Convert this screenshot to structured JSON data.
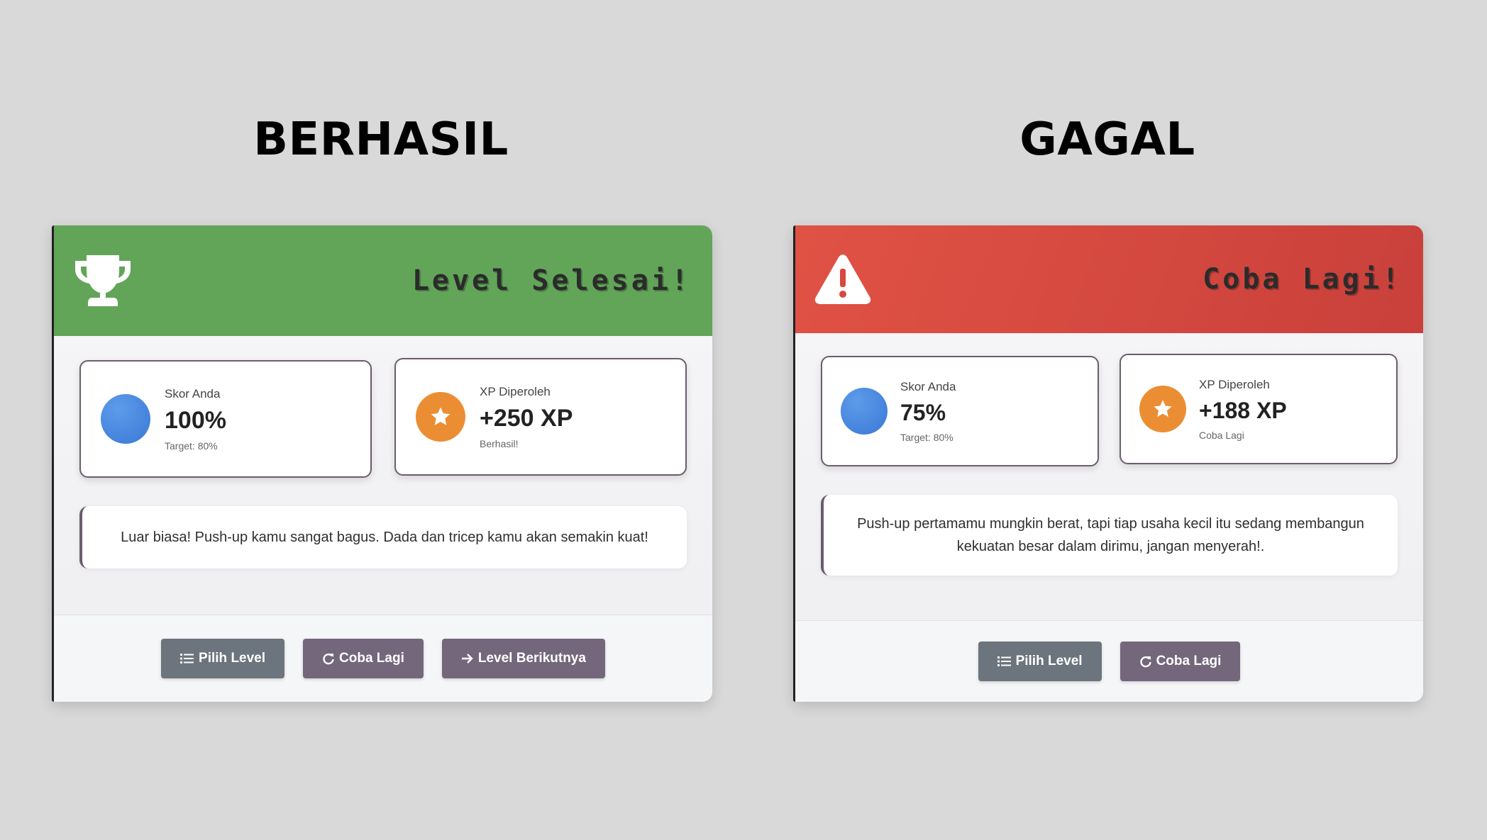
{
  "panels": {
    "success": {
      "heading": "BERHASIL",
      "title": "Level Selesai!",
      "header_icon": "trophy-icon",
      "header_color": "#62a559",
      "score": {
        "label": "Skor Anda",
        "value": "100%",
        "sub": "Target: 80%"
      },
      "xp": {
        "label": "XP Diperoleh",
        "value": "+250 XP",
        "sub": "Berhasil!"
      },
      "message": "Luar biasa! Push-up kamu sangat bagus. Dada dan tricep kamu akan semakin kuat!",
      "buttons": {
        "choose_level": "Pilih Level",
        "retry": "Coba Lagi",
        "next_level": "Level Berikutnya"
      }
    },
    "fail": {
      "heading": "GAGAL",
      "title": "Coba Lagi!",
      "header_icon": "warning-triangle-icon",
      "header_color": "#d8483f",
      "score": {
        "label": "Skor Anda",
        "value": "75%",
        "sub": "Target: 80%"
      },
      "xp": {
        "label": "XP Diperoleh",
        "value": "+188 XP",
        "sub": "Coba Lagi"
      },
      "message": "Push-up pertamamu mungkin berat, tapi tiap usaha kecil itu sedang membangun kekuatan besar dalam dirimu, jangan menyerah!.",
      "buttons": {
        "choose_level": "Pilih Level",
        "retry": "Coba Lagi"
      }
    }
  },
  "colors": {
    "score_icon": "#3a79d6",
    "xp_icon": "#eb8e33",
    "button_grey": "#6c757d",
    "button_purple": "#74677c"
  }
}
